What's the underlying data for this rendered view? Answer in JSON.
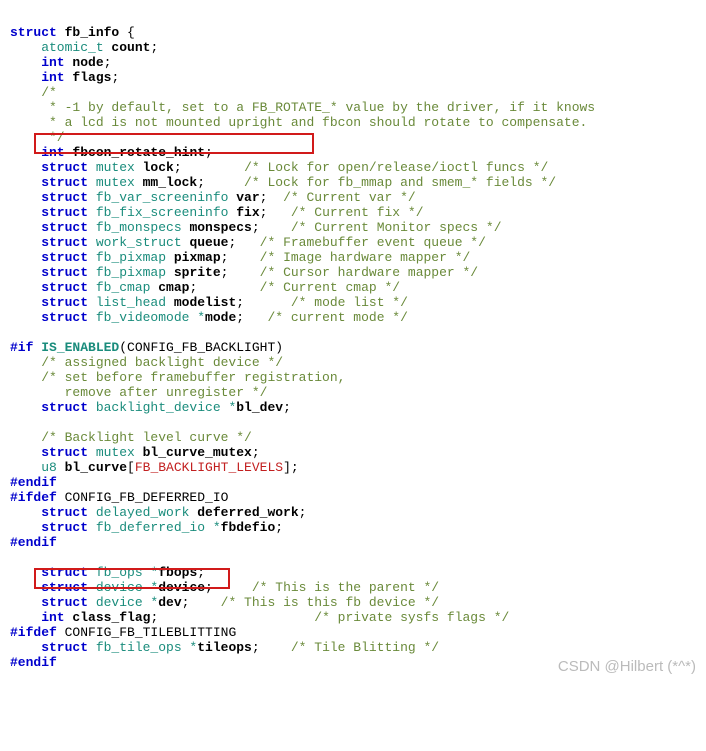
{
  "lines": {
    "l1a": "struct",
    "l1b": " fb_info ",
    "l1c": "{",
    "l2a": "    atomic_t ",
    "l2b": "count",
    "l2c": ";",
    "l3a": "    int ",
    "l3b": "node",
    "l3c": ";",
    "l4a": "    int ",
    "l4b": "flags",
    "l4c": ";",
    "l5": "    /*",
    "l6": "     * -1 by default, set to a FB_ROTATE_* value by the driver, if it knows",
    "l7": "     * a lcd is not mounted upright and fbcon should rotate to compensate.",
    "l8": "     */",
    "l9a": "    int ",
    "l9b": "fbcon_rotate_hint",
    "l9c": ";",
    "l10a": "    struct",
    "l10b": " mutex ",
    "l10c": "lock",
    "l10d": ";        ",
    "l10e": "/* Lock for open/release/ioctl funcs */",
    "l11a": "    struct",
    "l11b": " mutex ",
    "l11c": "mm_lock",
    "l11d": ";     ",
    "l11e": "/* Lock for fb_mmap and smem_* fields */",
    "l12a": "    struct",
    "l12b": " fb_var_screeninfo ",
    "l12c": "var",
    "l12d": ";  ",
    "l12e": "/* Current var */",
    "l13a": "    struct",
    "l13b": " fb_fix_screeninfo ",
    "l13c": "fix",
    "l13d": ";   ",
    "l13e": "/* Current fix */",
    "l14a": "    struct",
    "l14b": " fb_monspecs ",
    "l14c": "monspecs",
    "l14d": ";    ",
    "l14e": "/* Current Monitor specs */",
    "l15a": "    struct",
    "l15b": " work_struct ",
    "l15c": "queue",
    "l15d": ";   ",
    "l15e": "/* Framebuffer event queue */",
    "l16a": "    struct",
    "l16b": " fb_pixmap ",
    "l16c": "pixmap",
    "l16d": ";    ",
    "l16e": "/* Image hardware mapper */",
    "l17a": "    struct",
    "l17b": " fb_pixmap ",
    "l17c": "sprite",
    "l17d": ";    ",
    "l17e": "/* Cursor hardware mapper */",
    "l18a": "    struct",
    "l18b": " fb_cmap ",
    "l18c": "cmap",
    "l18d": ";        ",
    "l18e": "/* Current cmap */",
    "l19a": "    struct",
    "l19b": " list_head ",
    "l19c": "modelist",
    "l19d": ";      ",
    "l19e": "/* mode list */",
    "l20a": "    struct",
    "l20b": " fb_videomode *",
    "l20c": "mode",
    "l20d": ";   ",
    "l20e": "/* current mode */",
    "l21": "",
    "l22a": "#if ",
    "l22b": "IS_ENABLED",
    "l22c": "(CONFIG_FB_BACKLIGHT)",
    "l23": "    /* assigned backlight device */",
    "l24": "    /* set before framebuffer registration,",
    "l25": "       remove after unregister */",
    "l26a": "    struct",
    "l26b": " backlight_device *",
    "l26c": "bl_dev",
    "l26d": ";",
    "l27": "",
    "l28": "    /* Backlight level curve */",
    "l29a": "    struct",
    "l29b": " mutex ",
    "l29c": "bl_curve_mutex",
    "l29d": ";",
    "l30a": "    u8 ",
    "l30b": "bl_curve",
    "l30c": "[",
    "l30d": "FB_BACKLIGHT_LEVELS",
    "l30e": "];",
    "l31": "#endif",
    "l32a": "#ifdef",
    "l32b": " CONFIG_FB_DEFERRED_IO",
    "l33a": "    struct",
    "l33b": " delayed_work ",
    "l33c": "deferred_work",
    "l33d": ";",
    "l34a": "    struct",
    "l34b": " fb_deferred_io *",
    "l34c": "fbdefio",
    "l34d": ";",
    "l35": "#endif",
    "l36": "",
    "l37a": "    struct",
    "l37b": " fb_ops *",
    "l37c": "fbops",
    "l37d": ";",
    "l38a": "    struct",
    "l38b": " device *",
    "l38c": "device",
    "l38d": ";     ",
    "l38e": "/* This is the parent */",
    "l39a": "    struct",
    "l39b": " device *",
    "l39c": "dev",
    "l39d": ";    ",
    "l39e": "/* This is this fb device */",
    "l40a": "    int ",
    "l40b": "class_flag",
    "l40c": ";                    ",
    "l40e": "/* private sysfs flags */",
    "l41a": "#ifdef",
    "l41b": " CONFIG_FB_TILEBLITTING",
    "l42a": "    struct",
    "l42b": " fb_tile_ops *",
    "l42c": "tileops",
    "l42d": ";    ",
    "l42e": "/* Tile Blitting */",
    "l43": "#endif"
  },
  "watermark": "CSDN @Hilbert  (*^*)",
  "boxes": {
    "b1": true,
    "b2": true
  }
}
